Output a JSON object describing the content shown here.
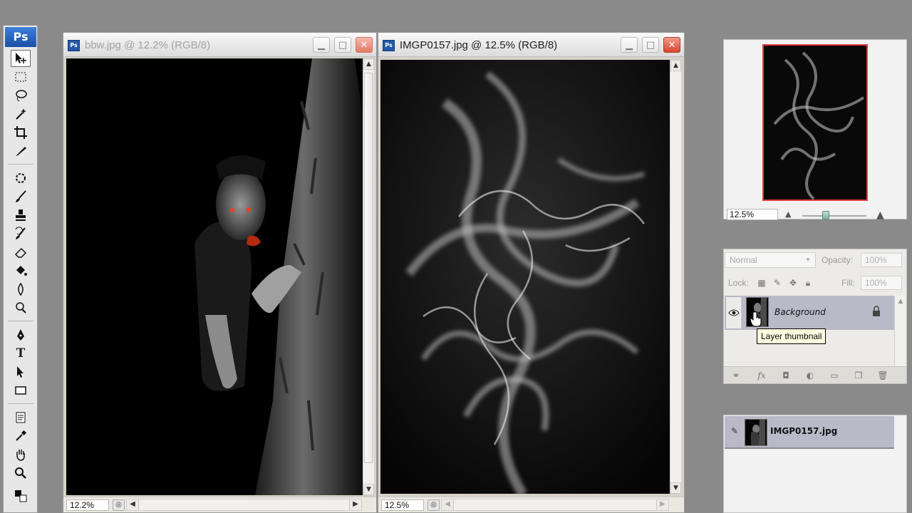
{
  "app": {
    "logo": "Ps"
  },
  "tools": [
    {
      "name": "move-tool",
      "icon": "move-icon",
      "selected": true
    },
    {
      "name": "marquee-tool",
      "icon": "marquee-icon"
    },
    {
      "name": "lasso-tool",
      "icon": "lasso-icon"
    },
    {
      "name": "magic-wand-tool",
      "icon": "magic-wand-icon"
    },
    {
      "name": "crop-tool",
      "icon": "crop-icon"
    },
    {
      "name": "slice-tool",
      "icon": "slice-icon"
    },
    {
      "name": "healing-tool",
      "icon": "healing-icon"
    },
    {
      "name": "brush-tool",
      "icon": "brush-icon"
    },
    {
      "name": "clone-stamp-tool",
      "icon": "stamp-icon"
    },
    {
      "name": "history-brush-tool",
      "icon": "history-brush-icon"
    },
    {
      "name": "eraser-tool",
      "icon": "eraser-icon"
    },
    {
      "name": "paint-bucket-tool",
      "icon": "bucket-icon"
    },
    {
      "name": "blur-tool",
      "icon": "blur-icon"
    },
    {
      "name": "dodge-tool",
      "icon": "dodge-icon"
    },
    {
      "name": "pen-tool",
      "icon": "pen-icon"
    },
    {
      "name": "type-tool",
      "icon": "type-icon",
      "glyph": "T"
    },
    {
      "name": "path-selection-tool",
      "icon": "path-selection-icon"
    },
    {
      "name": "shape-tool",
      "icon": "rectangle-icon"
    },
    {
      "name": "notes-tool",
      "icon": "notes-icon"
    },
    {
      "name": "eyedropper-tool",
      "icon": "eyedropper-icon"
    },
    {
      "name": "hand-tool",
      "icon": "hand-icon"
    },
    {
      "name": "zoom-tool",
      "icon": "zoom-icon"
    },
    {
      "name": "color-swatches",
      "icon": "color-swatch-icon"
    }
  ],
  "documents": [
    {
      "title": "bbw.jpg @ 12.2% (RGB/8)",
      "zoom": "12.2%",
      "active": false
    },
    {
      "title": "IMGP0157.jpg @ 12.5% (RGB/8)",
      "zoom": "12.5%",
      "active": true
    }
  ],
  "navigator": {
    "zoom": "12.5%"
  },
  "layers": {
    "blend_mode": "Normal",
    "opacity_label": "Opacity:",
    "opacity_value": "100%",
    "lock_label": "Lock:",
    "fill_label": "Fill:",
    "fill_value": "100%",
    "layer_name": "Background",
    "tooltip": "Layer thumbnail"
  },
  "history": {
    "snapshot_name": "IMGP0157.jpg"
  },
  "colors": {
    "close_button": "#d8452e",
    "navigator_frame": "#e53c3c",
    "layer_selected": "#b9b9c8"
  }
}
